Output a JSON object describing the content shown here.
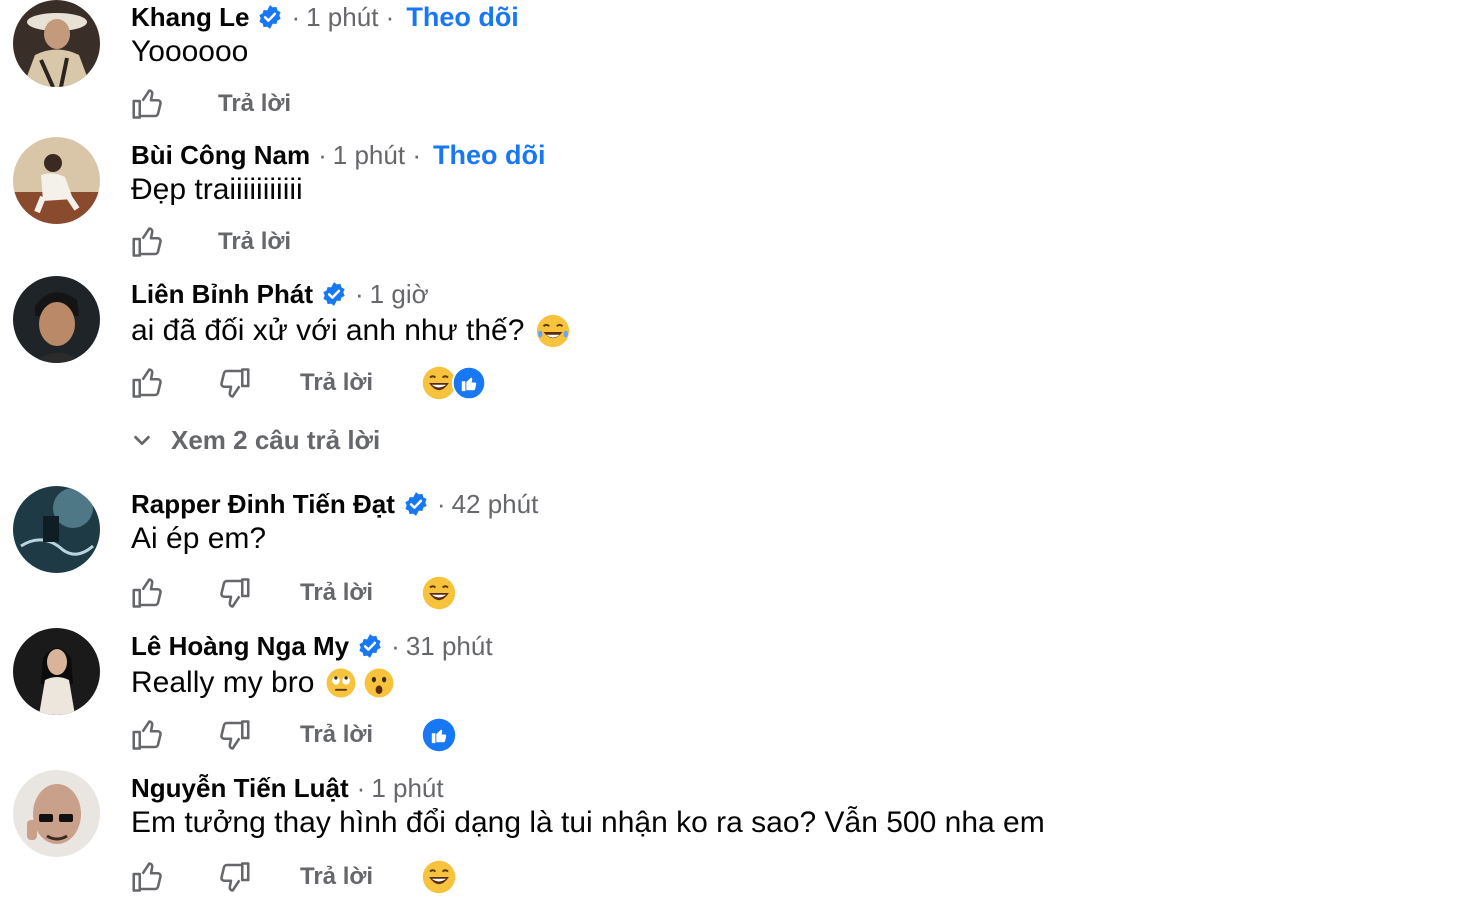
{
  "comments": [
    {
      "name": "Khang Le",
      "verified": true,
      "time": "1 phút",
      "follow": "Theo dõi",
      "text": "Yoooooo",
      "reply": "Trả lời",
      "dislike": false,
      "reactions": []
    },
    {
      "name": "Bùi Công Nam",
      "verified": false,
      "time": "1 phút",
      "follow": "Theo dõi",
      "text": "Đẹp traiiiiiiiiiii",
      "reply": "Trả lời",
      "dislike": false,
      "reactions": []
    },
    {
      "name": "Liên Bỉnh Phát",
      "verified": true,
      "time": "1 giờ",
      "follow": "",
      "text": "ai đã đối xử với anh như thế?",
      "text_emoji": "laughing-tears",
      "reply": "Trả lời",
      "dislike": true,
      "reactions": [
        "haha",
        "like"
      ],
      "view_replies": "Xem 2 câu trả lời"
    },
    {
      "name": "Rapper Đinh Tiến Đạt",
      "verified": true,
      "time": "42 phút",
      "follow": "",
      "text": "Ai ép em?",
      "reply": "Trả lời",
      "dislike": true,
      "reactions": [
        "haha"
      ]
    },
    {
      "name": "Lê Hoàng Nga My",
      "verified": true,
      "time": "31 phút",
      "follow": "",
      "text": "Really my bro",
      "text_emoji": "eye-roll, astonished",
      "reply": "Trả lời",
      "dislike": true,
      "reactions": [
        "like"
      ]
    },
    {
      "name": "Nguyễn Tiến Luật",
      "verified": false,
      "time": "1 phút",
      "follow": "",
      "text": "Em tưởng thay hình đổi dạng là tui nhận ko ra sao? Vẫn 500 nha em",
      "reply": "Trả lời",
      "dislike": true,
      "reactions": [
        "haha"
      ]
    }
  ],
  "colors": {
    "link": "#1877f2",
    "meta": "#65676b",
    "text": "#050505",
    "verified": "#1877f2"
  },
  "icons": {
    "like": "thumbs-up-icon",
    "dislike": "thumbs-down-icon",
    "verified": "verified-badge-icon",
    "expand": "chevron-down-icon"
  },
  "separator": "·"
}
